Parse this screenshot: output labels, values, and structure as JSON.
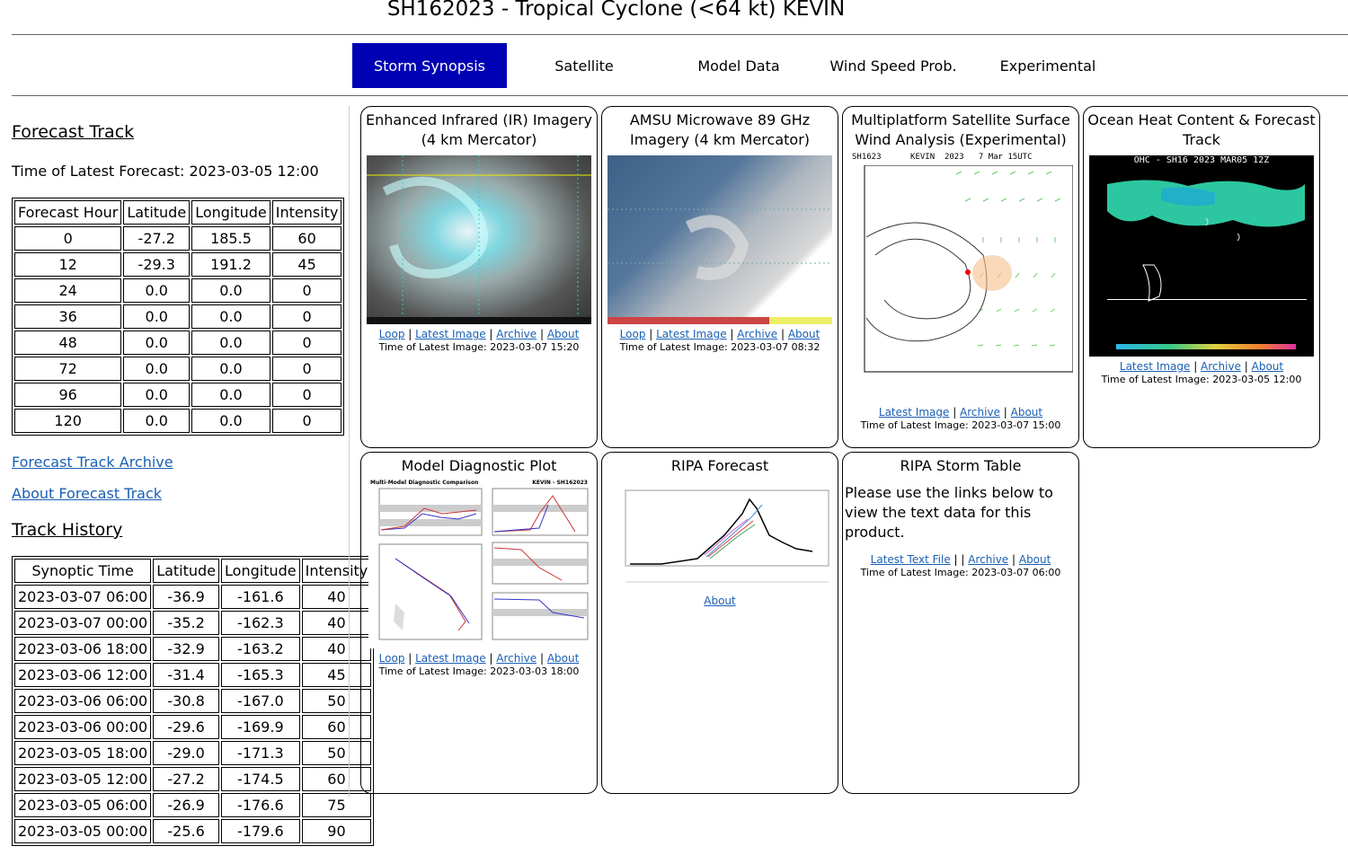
{
  "page": {
    "title": "SH162023 - Tropical Cyclone (<64 kt) KEVIN"
  },
  "nav": {
    "items": [
      {
        "label": "Storm Synopsis"
      },
      {
        "label": "Satellite"
      },
      {
        "label": "Model Data"
      },
      {
        "label": "Wind Speed Prob."
      },
      {
        "label": "Experimental"
      }
    ]
  },
  "forecast": {
    "heading": "Forecast Track",
    "latest_label": "Time of Latest Forecast: 2023-03-05 12:00",
    "columns": [
      "Forecast Hour",
      "Latitude",
      "Longitude",
      "Intensity"
    ],
    "rows": [
      [
        "0",
        "-27.2",
        "185.5",
        "60"
      ],
      [
        "12",
        "-29.3",
        "191.2",
        "45"
      ],
      [
        "24",
        "0.0",
        "0.0",
        "0"
      ],
      [
        "36",
        "0.0",
        "0.0",
        "0"
      ],
      [
        "48",
        "0.0",
        "0.0",
        "0"
      ],
      [
        "72",
        "0.0",
        "0.0",
        "0"
      ],
      [
        "96",
        "0.0",
        "0.0",
        "0"
      ],
      [
        "120",
        "0.0",
        "0.0",
        "0"
      ]
    ],
    "archive_link": "Forecast Track Archive",
    "about_link": "About Forecast Track"
  },
  "history": {
    "heading": "Track History",
    "columns": [
      "Synoptic Time",
      "Latitude",
      "Longitude",
      "Intensity"
    ],
    "rows": [
      [
        "2023-03-07 06:00",
        "-36.9",
        "-161.6",
        "40"
      ],
      [
        "2023-03-07 00:00",
        "-35.2",
        "-162.3",
        "40"
      ],
      [
        "2023-03-06 18:00",
        "-32.9",
        "-163.2",
        "40"
      ],
      [
        "2023-03-06 12:00",
        "-31.4",
        "-165.3",
        "45"
      ],
      [
        "2023-03-06 06:00",
        "-30.8",
        "-167.0",
        "50"
      ],
      [
        "2023-03-06 00:00",
        "-29.6",
        "-169.9",
        "60"
      ],
      [
        "2023-03-05 18:00",
        "-29.0",
        "-171.3",
        "50"
      ],
      [
        "2023-03-05 12:00",
        "-27.2",
        "-174.5",
        "60"
      ],
      [
        "2023-03-05 06:00",
        "-26.9",
        "-176.6",
        "75"
      ],
      [
        "2023-03-05 00:00",
        "-25.6",
        "-179.6",
        "90"
      ]
    ]
  },
  "panels": {
    "ir": {
      "title": "Enhanced Infrared (IR) Imagery (4 km Mercator)",
      "loop": "Loop",
      "latest": "Latest Image",
      "archive": "Archive",
      "about": "About",
      "time": "Time of Latest Image: 2023-03-07 15:20"
    },
    "amsu": {
      "title": "AMSU Microwave 89 GHz Imagery (4 km Mercator)",
      "loop": "Loop",
      "latest": "Latest Image",
      "archive": "Archive",
      "about": "About",
      "time": "Time of Latest Image: 2023-03-07 08:32"
    },
    "wind": {
      "title": "Multiplatform Satellite Surface Wind Analysis (Experimental)",
      "img_header": "SH1623      KEVIN  2023   7 Mar 15UTC",
      "latest": "Latest Image",
      "archive": "Archive",
      "about": "About",
      "time": "Time of Latest Image: 2023-03-07 15:00"
    },
    "ohc": {
      "title": "Ocean Heat Content & Forecast Track",
      "img_header": "OHC - SH16 2023 MAR05 12Z",
      "latest": "Latest Image",
      "archive": "Archive",
      "about": "About",
      "time": "Time of Latest Image: 2023-03-05 12:00"
    },
    "model": {
      "title": "Model Diagnostic Plot",
      "img_header_left": "Multi-Model Diagnostic Comparison",
      "img_header_right": "KEVIN - SH162023",
      "loop": "Loop",
      "latest": "Latest Image",
      "archive": "Archive",
      "about": "About",
      "time": "Time of Latest Image: 2023-03-03 18:00"
    },
    "ripa": {
      "title": "RIPA Forecast",
      "about": "About"
    },
    "ripa_table": {
      "title": "RIPA Storm Table",
      "text": "Please use the links below to view the text data for this product.",
      "text_file": "Latest Text File",
      "sep": "| |",
      "archive": "Archive",
      "about": "About",
      "time": "Time of Latest Image: 2023-03-07 06:00"
    }
  },
  "colors": {
    "nav_active": "#0000b4",
    "link": "#1a5fb4"
  }
}
